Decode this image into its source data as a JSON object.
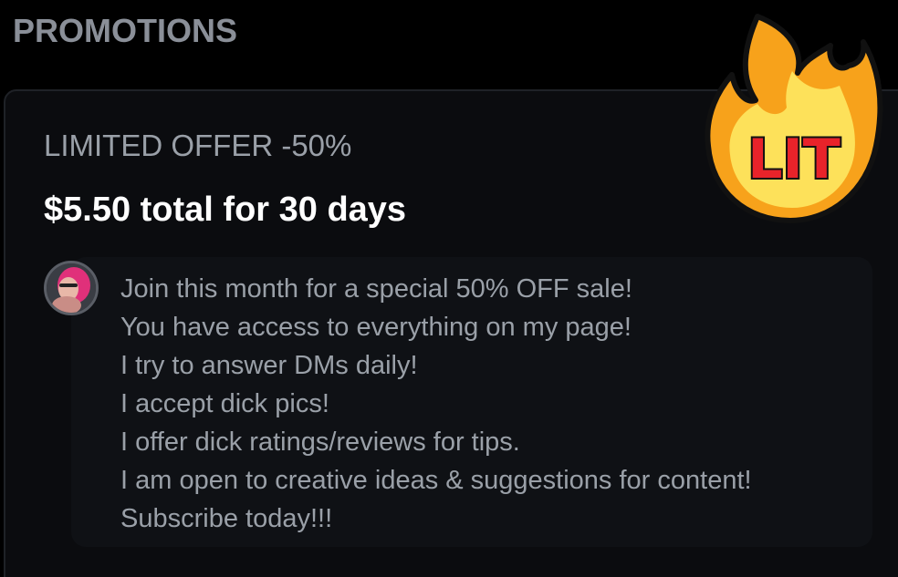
{
  "section": {
    "title": "PROMOTIONS"
  },
  "offer": {
    "label": "LIMITED OFFER -50%",
    "price_text": "$5.50 total for 30 days"
  },
  "message": {
    "lines": [
      "Join this month for a special 50% OFF sale!",
      "You have access to everything on my page!",
      "I try to answer DMs daily!",
      "I accept dick pics!",
      "I offer dick ratings/reviews for tips.",
      "I am open to creative ideas & suggestions for content!",
      "Subscribe today!!!"
    ]
  },
  "sticker": {
    "text": "LIT",
    "icon": "fire-icon",
    "colors": {
      "flame_outer": "#f7a21b",
      "flame_inner": "#fde15a",
      "text": "#e8232a",
      "stroke": "#111111"
    }
  },
  "colors": {
    "background": "#000000",
    "card": "#0b0c0f",
    "muted_text": "#9aa0a8",
    "title_text": "#ffffff"
  }
}
